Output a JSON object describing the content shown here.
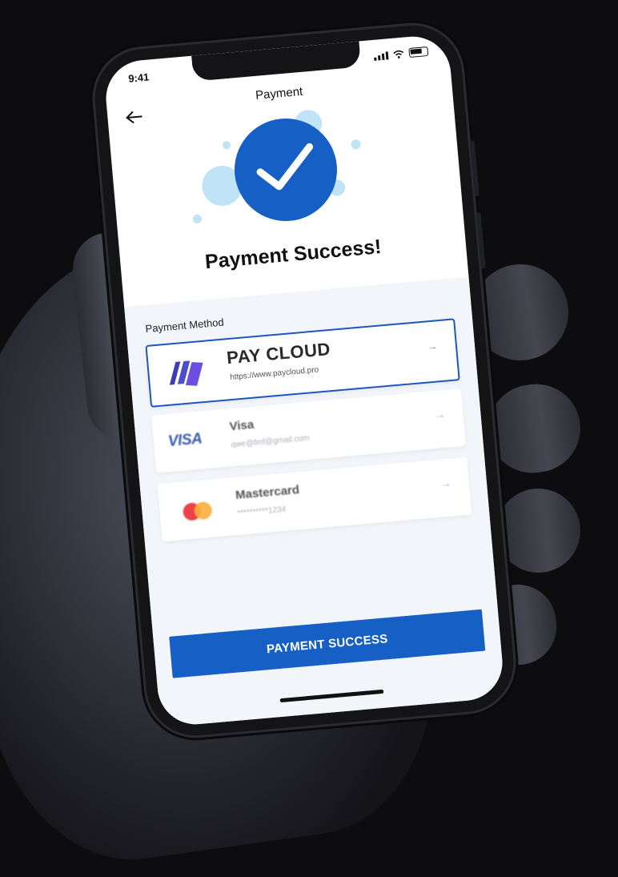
{
  "status_bar": {
    "time": "9:41"
  },
  "header": {
    "title": "Payment",
    "back_icon": "arrow-left-icon"
  },
  "success": {
    "icon": "checkmark-icon",
    "title": "Payment Success!"
  },
  "payment_method": {
    "label": "Payment Method",
    "options": [
      {
        "name": "PAY CLOUD",
        "detail": "https://www.paycloud.pro",
        "selected": true
      },
      {
        "name": "Visa",
        "detail": "qwe@fmf@gmail.com",
        "logo_text": "VISA",
        "selected": false
      },
      {
        "name": "Mastercard",
        "detail": "**********1234",
        "selected": false
      }
    ],
    "arrow_icon": "arrow-right-icon"
  },
  "button": {
    "label": "PAYMENT SUCCESS"
  },
  "colors": {
    "accent": "#1660c5",
    "bubble": "#bfe3f7",
    "panel": "#f2f5fa"
  }
}
